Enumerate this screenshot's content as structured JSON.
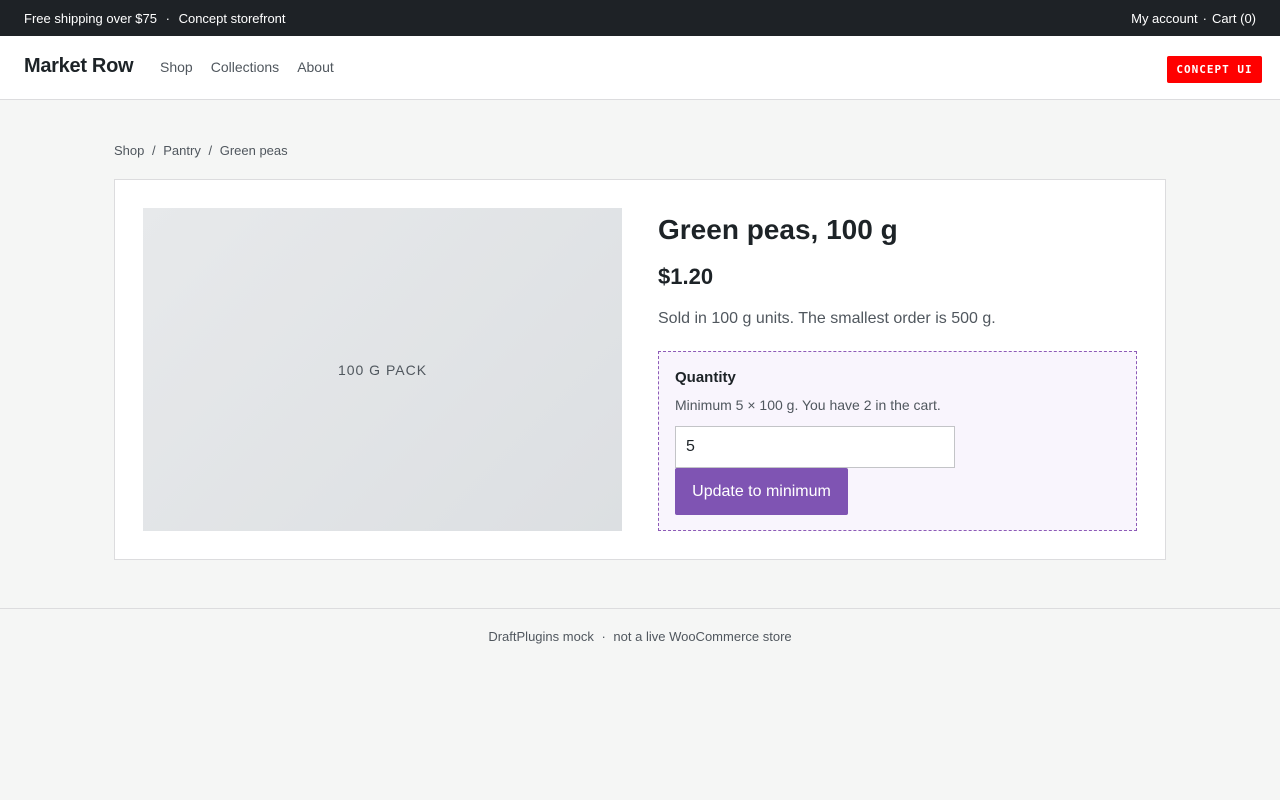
{
  "topbar": {
    "shipping_text": "Free shipping over $75",
    "separator": "·",
    "storefront_text": "Concept storefront",
    "my_account": "My account",
    "cart": "Cart (0)"
  },
  "header": {
    "logo": "Market Row",
    "nav": [
      "Shop",
      "Collections",
      "About"
    ],
    "badge": "CONCEPT UI"
  },
  "breadcrumb": {
    "items": [
      "Shop",
      "Pantry",
      "Green peas"
    ],
    "separator": "/"
  },
  "product": {
    "image_label": "100 G PACK",
    "title": "Green peas, 100 g",
    "price": "$1.20",
    "description": "Sold in 100 g units. The smallest order is 500 g."
  },
  "quantity": {
    "label": "Quantity",
    "hint": "Minimum 5 × 100 g. You have 2 in the cart.",
    "value": "5",
    "button_label": "Update to minimum"
  },
  "footer": {
    "left": "DraftPlugins mock",
    "separator": "·",
    "right": "not a live WooCommerce store"
  },
  "colors": {
    "topbar_bg": "#1e2226",
    "badge_bg": "#ff0000",
    "accent_purple": "#7f54b3",
    "qty_box_bg": "#f9f5fd"
  }
}
